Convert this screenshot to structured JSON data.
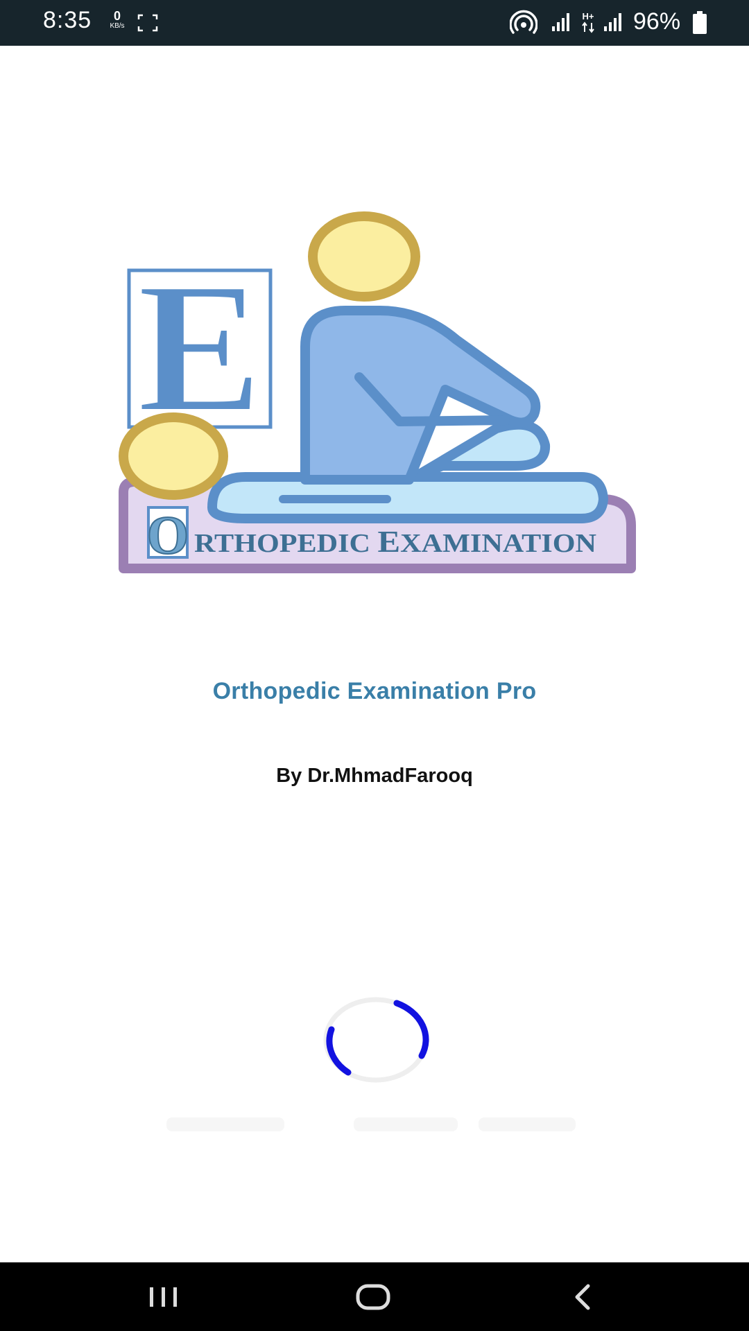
{
  "status_bar": {
    "time": "8:35",
    "net_speed_value": "0",
    "net_speed_unit": "KB/s",
    "network_type": "H+",
    "battery_percent": "96%",
    "icons": [
      "focus-icon",
      "hotspot-icon",
      "signal-icon",
      "signal-icon",
      "battery-icon"
    ]
  },
  "splash": {
    "logo_letter_e": "E",
    "logo_letter_o": "O",
    "logo_text_part1": "RTHOPEDIC ",
    "logo_text_e": "E",
    "logo_text_part2": "XAMINATION",
    "app_title": "Orthopedic Examination Pro",
    "author": "By Dr.MhmadFarooq"
  },
  "colors": {
    "title": "#3a7fa8",
    "spinner": "#1212e0",
    "status_bar_bg": "#17252c",
    "nav_bar_bg": "#000000",
    "logo_blue": "#5b8fc9",
    "logo_light_blue": "#a8ddf7",
    "logo_head_fill": "#fbeea0",
    "logo_head_stroke": "#c9a84a",
    "logo_table_fill": "#e3d8f0",
    "logo_table_stroke": "#9b7fb3"
  },
  "nav_bar": {
    "icons": [
      "recents-icon",
      "home-icon",
      "back-icon"
    ]
  }
}
